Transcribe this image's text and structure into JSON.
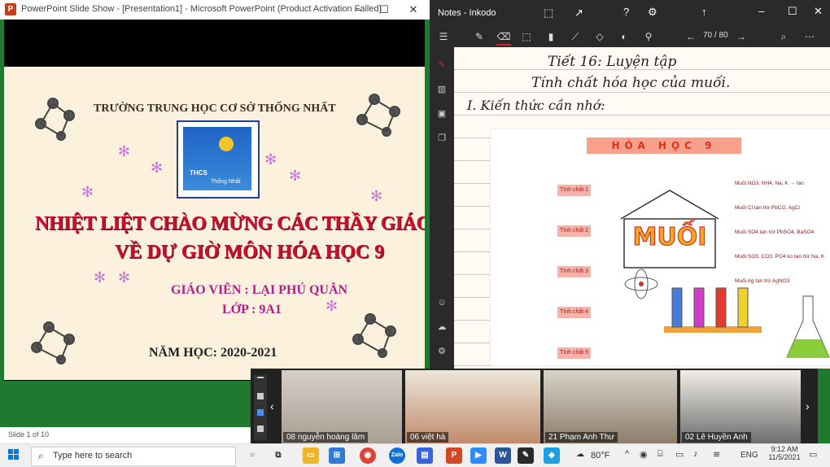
{
  "ppt": {
    "title": "PowerPoint Slide Show - [Presentation1] - Microsoft PowerPoint (Product Activation Failed)",
    "status": "Slide 1 of 10",
    "slide": {
      "school": "TRƯỜNG TRUNG HỌC CƠ SỞ THỐNG NHẤT",
      "logo_top": "THCS",
      "logo_name": "Thống Nhất",
      "line1": "NHIỆT LIỆT CHÀO MỪNG CÁC THẦY GIÁO, CÔ GIÁO",
      "line2": "VỀ DỰ GIỜ MÔN HÓA HỌC 9",
      "teacher": "GIÁO VIÊN : LẠI PHÚ QUÂN",
      "class": "LỚP : 9A1",
      "year": "NĂM HỌC: 2020-2021"
    }
  },
  "ink": {
    "title": "Notes - Inkodo",
    "page_counter": "70 / 80",
    "note": {
      "line1": "Tiết 16: Luyện tập",
      "line2": "Tính chất hóa học của muối.",
      "line3": "I. Kiến thức cần nhớ:"
    },
    "poster": {
      "banner": "HÓA HỌC 9",
      "center": "MUỐI",
      "left_items": [
        "Tính chất 1",
        "Tính chất 2",
        "Tính chất 3",
        "Tính chất 4",
        "Tính chất 5"
      ],
      "right_items": [
        "Muối NO3, NH4, Na, K → tan",
        "Muối Cl tan trừ PbCl2, AgCl",
        "Muối SO4 tan trừ PbSO4, BaSO4",
        "Muối SO3, CO3, PO4 ko tan trừ Na, K",
        "Muối Ag tan trừ AgNO3"
      ]
    }
  },
  "zoom": {
    "participants": [
      "08 nguyễn hoàng lâm",
      "06 việt hà",
      "21 Phạm Anh Thư",
      "02 Lê Huyền Anh"
    ]
  },
  "taskbar": {
    "search_placeholder": "Type here to search",
    "temperature": "80°F",
    "language": "ENG",
    "time": "9:12 AM",
    "date": "11/5/2021"
  }
}
